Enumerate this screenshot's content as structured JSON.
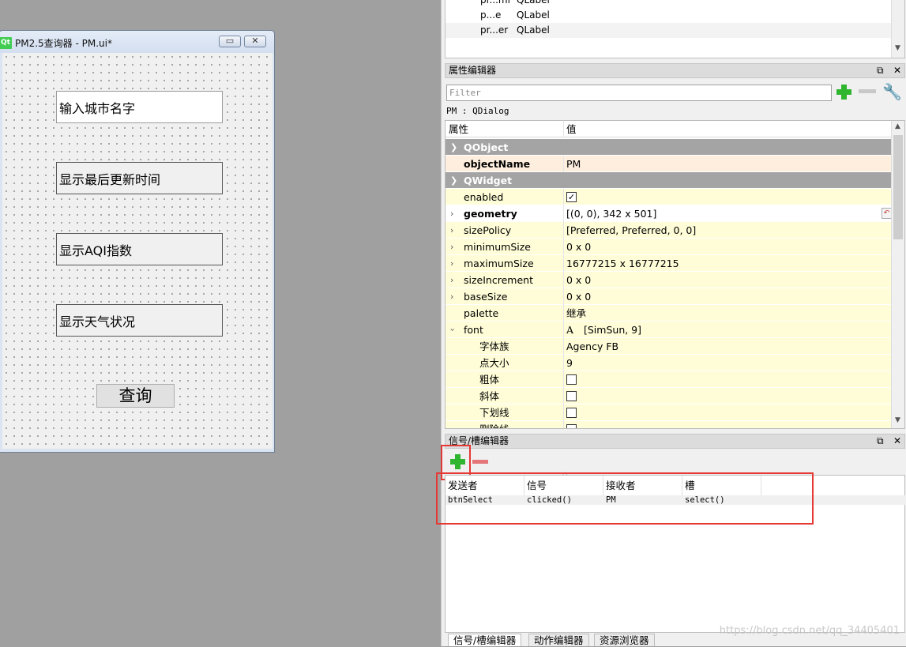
{
  "form": {
    "title": "PM2.5查询器 - PM.ui*",
    "logo": "Qt",
    "minimize_glyph": "▭",
    "close_glyph": "✕",
    "city_input_text": "输入城市名字",
    "labels": [
      "显示最后更新时间",
      "显示AQI指数",
      "显示天气状况"
    ],
    "query_button": "查询"
  },
  "object_list": [
    {
      "name": "pr...ml",
      "cls": "QLabel"
    },
    {
      "name": "p...e",
      "cls": "QLabel"
    },
    {
      "name": "pr...er",
      "cls": "QLabel"
    }
  ],
  "property_editor": {
    "title": "属性编辑器",
    "filter_placeholder": "Filter",
    "class_line": "PM : QDialog",
    "header_property": "属性",
    "header_value": "值",
    "rows": [
      {
        "kind": "section",
        "name": "QObject"
      },
      {
        "kind": "prop",
        "name": "objectName",
        "value": "PM",
        "bold": true,
        "bg": "pink"
      },
      {
        "kind": "section",
        "name": "QWidget"
      },
      {
        "kind": "check",
        "name": "enabled",
        "checked": true
      },
      {
        "kind": "prop",
        "name": "geometry",
        "value": "[(0, 0), 342 x 501]",
        "bold": true,
        "bg": "white",
        "expandable": true,
        "reset": true
      },
      {
        "kind": "prop",
        "name": "sizePolicy",
        "value": "[Preferred, Preferred, 0, 0]",
        "expandable": true
      },
      {
        "kind": "prop",
        "name": "minimumSize",
        "value": "0 x 0",
        "expandable": true
      },
      {
        "kind": "prop",
        "name": "maximumSize",
        "value": "16777215 x 16777215",
        "expandable": true
      },
      {
        "kind": "prop",
        "name": "sizeIncrement",
        "value": "0 x 0",
        "expandable": true
      },
      {
        "kind": "prop",
        "name": "baseSize",
        "value": "0 x 0",
        "expandable": true
      },
      {
        "kind": "prop",
        "name": "palette",
        "value": "继承"
      },
      {
        "kind": "prop",
        "name": "font",
        "value": "[SimSun, 9]",
        "expanded": true,
        "font_icon": "A"
      },
      {
        "kind": "sub",
        "name": "字体族",
        "value": "Agency FB"
      },
      {
        "kind": "sub",
        "name": "点大小",
        "value": "9"
      },
      {
        "kind": "subcheck",
        "name": "粗体",
        "checked": false
      },
      {
        "kind": "subcheck",
        "name": "斜体",
        "checked": false
      },
      {
        "kind": "subcheck",
        "name": "下划线",
        "checked": false
      },
      {
        "kind": "subcheck",
        "name": "删除线",
        "checked": false
      }
    ]
  },
  "signal_editor": {
    "title": "信号/槽编辑器",
    "headers": [
      "发送者",
      "信号",
      "接收者",
      "槽"
    ],
    "connections": [
      {
        "sender": "btnSelect",
        "signal": "clicked()",
        "receiver": "PM",
        "slot": "select()"
      }
    ]
  },
  "bottom_tabs": [
    "信号/槽编辑器",
    "动作编辑器",
    "资源浏览器"
  ],
  "watermark": "https://blog.csdn.net/qq_34405401",
  "colors": {
    "accent_red": "#e53935",
    "section_gray": "#a4a4a4",
    "row_yellow": "#fffdd7"
  }
}
